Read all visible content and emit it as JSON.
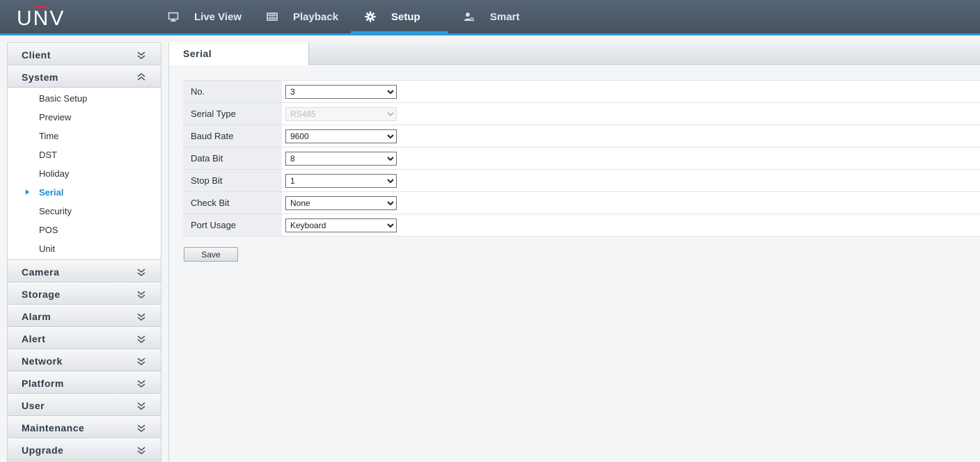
{
  "header": {
    "logo": "UNV",
    "nav": [
      {
        "label": "Live View",
        "icon": "monitor-icon",
        "active": false
      },
      {
        "label": "Playback",
        "icon": "film-icon",
        "active": false
      },
      {
        "label": "Setup",
        "icon": "gear-icon",
        "active": true
      },
      {
        "label": "Smart",
        "icon": "user-search-icon",
        "active": false
      }
    ]
  },
  "sidebar": {
    "groups": [
      {
        "label": "Client",
        "expanded": false
      },
      {
        "label": "System",
        "expanded": true,
        "items": [
          "Basic Setup",
          "Preview",
          "Time",
          "DST",
          "Holiday",
          "Serial",
          "Security",
          "POS",
          "Unit"
        ],
        "active_item": "Serial"
      },
      {
        "label": "Camera",
        "expanded": false
      },
      {
        "label": "Storage",
        "expanded": false
      },
      {
        "label": "Alarm",
        "expanded": false
      },
      {
        "label": "Alert",
        "expanded": false
      },
      {
        "label": "Network",
        "expanded": false
      },
      {
        "label": "Platform",
        "expanded": false
      },
      {
        "label": "User",
        "expanded": false
      },
      {
        "label": "Maintenance",
        "expanded": false
      },
      {
        "label": "Upgrade",
        "expanded": false
      }
    ]
  },
  "main": {
    "tab": "Serial",
    "fields": [
      {
        "label": "No.",
        "value": "3",
        "disabled": false
      },
      {
        "label": "Serial Type",
        "value": "RS485",
        "disabled": true
      },
      {
        "label": "Baud Rate",
        "value": "9600",
        "disabled": false
      },
      {
        "label": "Data Bit",
        "value": "8",
        "disabled": false
      },
      {
        "label": "Stop Bit",
        "value": "1",
        "disabled": false
      },
      {
        "label": "Check Bit",
        "value": "None",
        "disabled": false
      },
      {
        "label": "Port Usage",
        "value": "Keyboard",
        "disabled": false
      }
    ],
    "save_label": "Save"
  },
  "colors": {
    "header_bg": "#4e5b6a",
    "accent": "#2e9ad6",
    "logo_accent": "#e02f2f",
    "active_item": "#1e8fd0"
  }
}
